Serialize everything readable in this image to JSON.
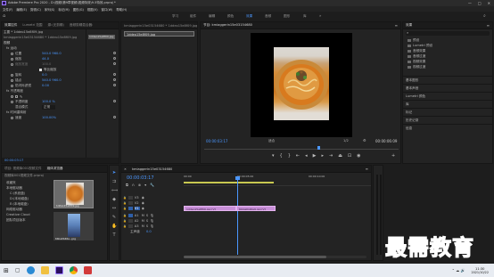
{
  "window": {
    "title": "Adobe Premiere Pro 2020 - D:\\视频\\第9章视频\\视频特效\\9.5特效.prproj *",
    "menu": [
      "文件(F)",
      "编辑(E)",
      "剪辑(C)",
      "序列(S)",
      "标记(M)",
      "图形(G)",
      "视图(V)",
      "窗口(W)",
      "帮助(H)"
    ],
    "workspaces": [
      "学习",
      "组件",
      "编辑",
      "颜色",
      "效果",
      "音频",
      "图形",
      "库"
    ],
    "active_workspace": "效果"
  },
  "effect_controls": {
    "tabs": [
      "效果控件",
      "Lumetri 范围",
      "源:(无剪辑)",
      "音频剪辑混合器:"
    ],
    "source_label": "主要 * 1ddeo15e8f09.jpg",
    "sequence_label": "kmiaggerin15e03154680 * 1ddeo15e8f09.jpg",
    "section_video": "视频",
    "motion": "fx 运动",
    "rows": [
      {
        "label": "位置",
        "value": "540.0  960.0"
      },
      {
        "label": "缩放",
        "value": "44.0"
      },
      {
        "label": "缩放宽度",
        "value": "100.0"
      },
      {
        "label": "",
        "value": "等比缩放",
        "checkbox": true
      },
      {
        "label": "旋转",
        "value": "0.0"
      },
      {
        "label": "锚点",
        "value": "540.0  960.0"
      },
      {
        "label": "防闪烁滤镜",
        "value": "0.00"
      }
    ],
    "opacity": "fx 不透明度",
    "opacity_rows": [
      {
        "label": "不透明度",
        "value": "100.0 %"
      },
      {
        "label": "混合模式",
        "value": "正常"
      }
    ],
    "time_remap": "fx 时间重映射",
    "time_remap_row": {
      "label": "速度",
      "value": "100.00%"
    },
    "timecode": "00:00:03:17",
    "clip_name": "1ddeo15e8f09.jpg"
  },
  "program_monitor": {
    "title": "节目: kmiaggerin15e03154680",
    "timecode_left": "00:00:03:17",
    "fit": "适合",
    "ratio": "1/2",
    "timecode_right": "00:00:06:09"
  },
  "effects_panel": {
    "title": "效果",
    "tree": [
      "预设",
      "Lumetri 预设",
      "音频效果",
      "音频过渡",
      "视频效果",
      "视频过渡"
    ],
    "sections": [
      "基本图形",
      "基本声音",
      "Lumetri 颜色",
      "库",
      "标记",
      "历史记录",
      "信息"
    ]
  },
  "project_panel": {
    "tabs": [
      "项目: 视频库001视频文件",
      "媒体浏览器"
    ],
    "path": "视频库001视频文件.prproj",
    "items": [
      "收藏夹",
      "本地驱动器",
      "C:(系统盘)",
      "D:(本地磁盘)",
      "E:(本地磁盘)",
      "网络驱动器",
      "Creative Cloud",
      "团队项目版本"
    ],
    "thumb1_label": "1ddeo15e8f09.jpg",
    "thumb2_label": "6bba0b46a...jpg"
  },
  "timeline": {
    "title": "kmiaggerin15e03154680",
    "timecode": "00:00:03:17",
    "ruler": [
      "00:00",
      "00:00:05:00",
      "00:00:10:00"
    ],
    "video_tracks": [
      "V3",
      "V2",
      "V1"
    ],
    "audio_tracks": [
      "A1",
      "A2",
      "A3"
    ],
    "master": "主声道",
    "master_value": "0.0",
    "clips": [
      {
        "name": "1ddeo15e8f09.jpg [V]"
      },
      {
        "name": "6bba0b46a9.jpg [V]"
      }
    ]
  },
  "taskbar": {
    "time": "11:30",
    "date": "2021/10/22"
  },
  "watermark": "最需教育",
  "colors": {
    "accent": "#4b97ff",
    "clip": "#c88fd8",
    "playhead": "#4b97ff"
  }
}
